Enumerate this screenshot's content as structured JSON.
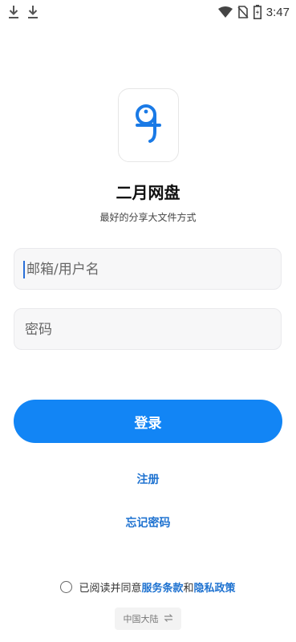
{
  "status_bar": {
    "time": "3:47",
    "left_icons": [
      "download-icon",
      "download-icon"
    ],
    "right_icons": [
      "wifi-icon",
      "no-sim-icon",
      "battery-icon"
    ]
  },
  "app": {
    "title": "二月网盘",
    "subtitle": "最好的分享大文件方式",
    "logo_icon": "app-logo-icon",
    "accent_color": "#1285f5"
  },
  "form": {
    "username_placeholder": "邮箱/用户名",
    "password_placeholder": "密码",
    "login_label": "登录"
  },
  "links": {
    "register": "注册",
    "forgot_password": "忘记密码"
  },
  "agreement": {
    "prefix": "已阅读并同意",
    "terms": "服务条款",
    "and": "和",
    "privacy": "隐私政策",
    "checked": false
  },
  "region": {
    "label": "中国大陆",
    "switch_icon": "swap-icon"
  }
}
